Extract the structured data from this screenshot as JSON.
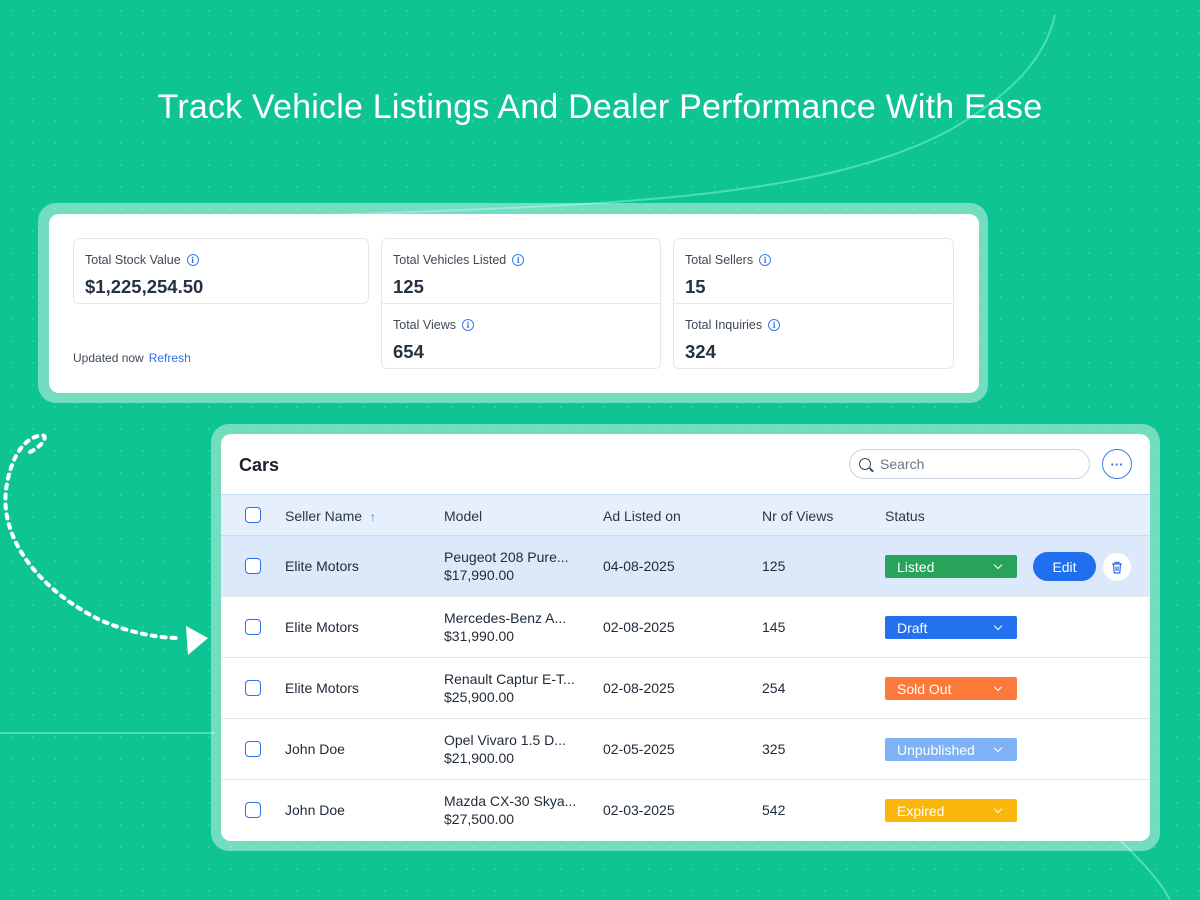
{
  "headline": "Track Vehicle Listings And Dealer Performance With Ease",
  "stats": {
    "stock": {
      "label": "Total Stock Value",
      "value": "$1,225,254.50"
    },
    "vehicles": {
      "label": "Total Vehicles Listed",
      "value": "125"
    },
    "views": {
      "label": "Total Views",
      "value": "654"
    },
    "sellers": {
      "label": "Total Sellers",
      "value": "15"
    },
    "inquiries": {
      "label": "Total Inquiries",
      "value": "324"
    },
    "updated_text": "Updated now",
    "refresh_label": "Refresh",
    "info_icon": "info-icon"
  },
  "table": {
    "title": "Cars",
    "search_placeholder": "Search",
    "more_label": "···",
    "edit_label": "Edit",
    "columns": {
      "seller": "Seller Name",
      "model": "Model",
      "date": "Ad Listed on",
      "views": "Nr of Views",
      "status": "Status"
    },
    "sort_indicator": "↑",
    "rows": [
      {
        "seller": "Elite Motors",
        "model": "Peugeot 208 Pure...",
        "price": "$17,990.00",
        "date": "04-08-2025",
        "views": "125",
        "status": "Listed",
        "status_color": "#27a35a",
        "selected": true
      },
      {
        "seller": "Elite Motors",
        "model": "Mercedes-Benz A...",
        "price": "$31,990.00",
        "date": "02-08-2025",
        "views": "145",
        "status": "Draft",
        "status_color": "#2371ee"
      },
      {
        "seller": "Elite Motors",
        "model": "Renault Captur E-T...",
        "price": "$25,900.00",
        "date": "02-08-2025",
        "views": "254",
        "status": "Sold Out",
        "status_color": "#fe7a3a"
      },
      {
        "seller": "John Doe",
        "model": "Opel Vivaro 1.5 D...",
        "price": "$21,900.00",
        "date": "02-05-2025",
        "views": "325",
        "status": "Unpublished",
        "status_color": "#7eb1f6"
      },
      {
        "seller": "John Doe",
        "model": "Mazda CX-30 Skya...",
        "price": "$27,500.00",
        "date": "02-03-2025",
        "views": "542",
        "status": "Expired",
        "status_color": "#fbb60b"
      }
    ]
  },
  "colors": {
    "background": "#0fc493",
    "accent": "#2f6ee8",
    "header_row": "#e6f0fd",
    "selected_row": "#dce9fb"
  }
}
